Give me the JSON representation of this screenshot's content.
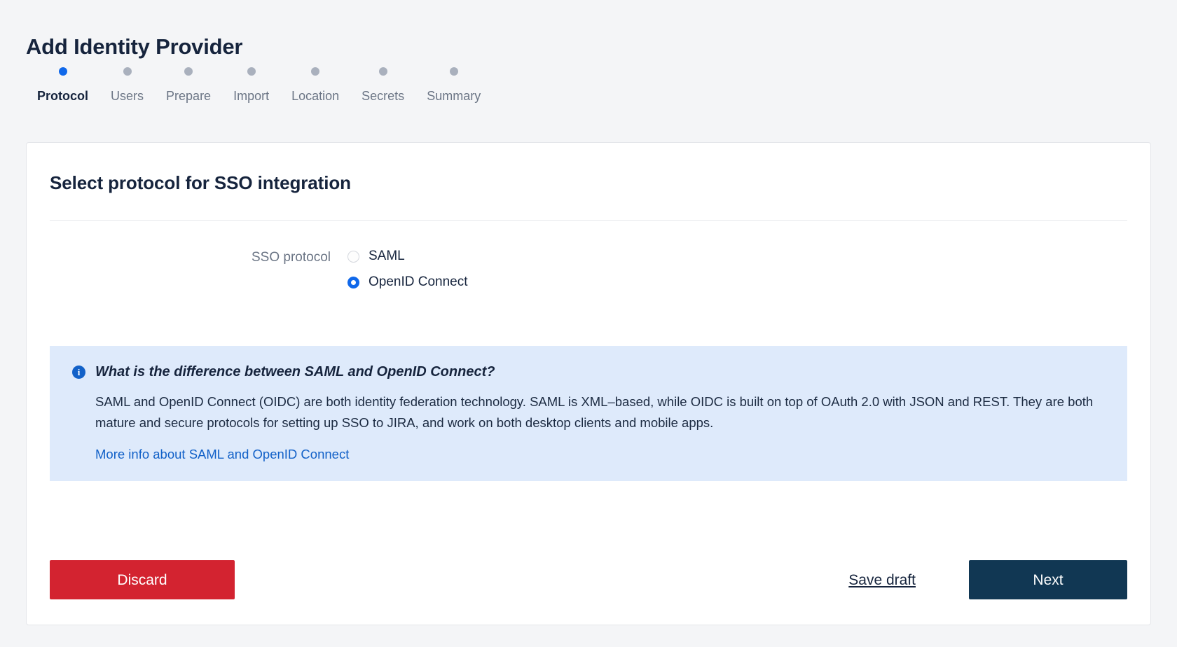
{
  "page": {
    "title": "Add Identity Provider",
    "background_color": "#f4f5f7"
  },
  "stepper": {
    "active_index": 0,
    "active_dot_color": "#1068ea",
    "inactive_dot_color": "#a9b0bd",
    "steps": [
      {
        "label": "Protocol"
      },
      {
        "label": "Users"
      },
      {
        "label": "Prepare"
      },
      {
        "label": "Import"
      },
      {
        "label": "Location"
      },
      {
        "label": "Secrets"
      },
      {
        "label": "Summary"
      }
    ]
  },
  "card": {
    "title": "Select protocol for SSO integration",
    "form": {
      "label": "SSO protocol",
      "options": [
        {
          "label": "SAML",
          "selected": false
        },
        {
          "label": "OpenID Connect",
          "selected": true
        }
      ]
    },
    "info": {
      "icon": "info-circle-icon",
      "title": "What is the difference between SAML and OpenID Connect?",
      "body": "SAML and OpenID Connect (OIDC) are both identity federation technology. SAML is XML–based, while OIDC is built on top of OAuth 2.0 with JSON and REST. They are both mature and secure protocols for setting up SSO to JIRA, and work on both desktop clients and mobile apps.",
      "link_text": "More info about SAML and OpenID Connect",
      "background_color": "#deeafb",
      "link_color": "#1261c8"
    },
    "actions": {
      "discard_label": "Discard",
      "save_draft_label": "Save draft",
      "next_label": "Next",
      "discard_color": "#d32330",
      "next_color": "#113753"
    }
  }
}
